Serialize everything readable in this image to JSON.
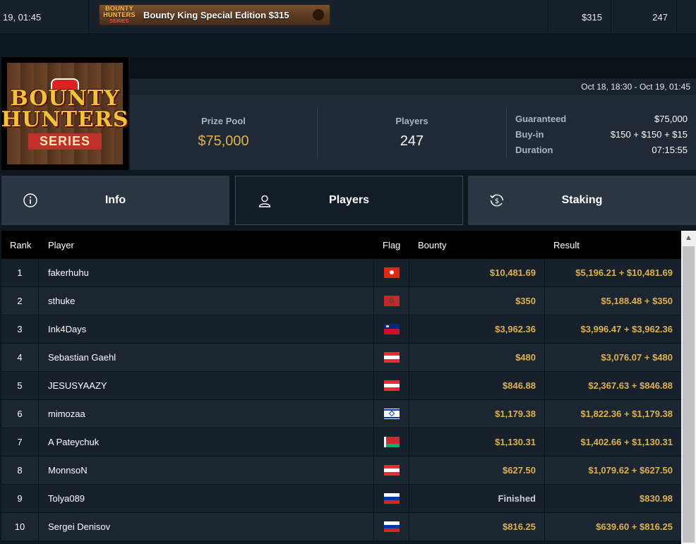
{
  "top_row": {
    "datetime": "19, 01:45",
    "banner_title": "Bounty King Special Edition $315",
    "banner_logo": [
      "BOUNTY",
      "HUNTERS",
      "SERIES"
    ],
    "buyin": "$315",
    "players": "247"
  },
  "logo": {
    "line1": "BOUNTY",
    "line2": "HUNTERS",
    "line3": "SERIES"
  },
  "header": {
    "date_range": "Oct 18, 18:30 - Oct 19, 01:45",
    "prize_pool_label": "Prize Pool",
    "prize_pool_value": "$75,000",
    "players_label": "Players",
    "players_value": "247",
    "details": [
      {
        "key": "Guaranteed",
        "value": "$75,000"
      },
      {
        "key": "Buy-in",
        "value": "$150 + $150 + $15"
      },
      {
        "key": "Duration",
        "value": "07:15:55"
      }
    ]
  },
  "tabs": [
    {
      "label": "Info",
      "icon": "info-icon",
      "active": false
    },
    {
      "label": "Players",
      "icon": "user-icon",
      "active": true
    },
    {
      "label": "Staking",
      "icon": "dollar-cycle-icon",
      "active": false
    }
  ],
  "table": {
    "columns": [
      "Rank",
      "Player",
      "Flag",
      "Bounty",
      "Result"
    ],
    "rows": [
      {
        "rank": "1",
        "player": "fakerhuhu",
        "flag": "hk",
        "bounty": "$10,481.69",
        "result": "$5,196.21 + $10,481.69"
      },
      {
        "rank": "2",
        "player": "sthuke",
        "flag": "ma",
        "bounty": "$350",
        "result": "$5,188.48 + $350"
      },
      {
        "rank": "3",
        "player": "Ink4Days",
        "flag": "li",
        "bounty": "$3,962.36",
        "result": "$3,996.47 + $3,962.36"
      },
      {
        "rank": "4",
        "player": "Sebastian Gaehl",
        "flag": "at",
        "bounty": "$480",
        "result": "$3,076.07 + $480"
      },
      {
        "rank": "5",
        "player": "JESUSYAAZY",
        "flag": "at",
        "bounty": "$846.88",
        "result": "$2,367.63 + $846.88"
      },
      {
        "rank": "6",
        "player": "mimozaa",
        "flag": "il",
        "bounty": "$1,179.38",
        "result": "$1,822.36 + $1,179.38"
      },
      {
        "rank": "7",
        "player": "A Pateychuk",
        "flag": "by",
        "bounty": "$1,130.31",
        "result": "$1,402.66 + $1,130.31"
      },
      {
        "rank": "8",
        "player": "MonnsoN",
        "flag": "at",
        "bounty": "$627.50",
        "result": "$1,079.62 + $627.50"
      },
      {
        "rank": "9",
        "player": "Tolya089",
        "flag": "ru",
        "bounty": "Finished",
        "result": "$830.98"
      },
      {
        "rank": "10",
        "player": "Sergei Denisov",
        "flag": "ru",
        "bounty": "$816.25",
        "result": "$639.60 + $816.25"
      }
    ]
  },
  "colors": {
    "gold": "#e0b04c",
    "panel": "#1f2a36",
    "tab": "#2b3643",
    "active_tab": "#131d27"
  }
}
